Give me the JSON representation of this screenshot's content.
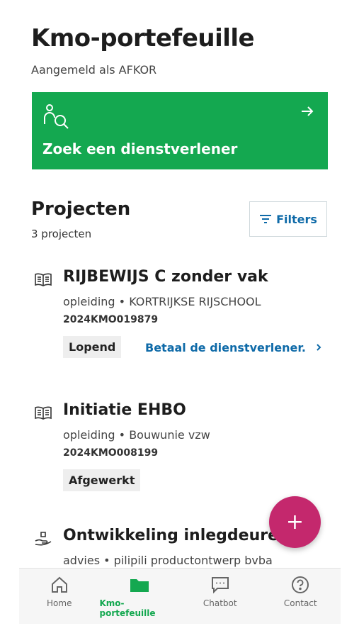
{
  "header": {
    "title": "Kmo-portefeuille",
    "subtitle": "Aangemeld als AFKOR"
  },
  "search_card": {
    "label": "Zoek een dienstverlener",
    "icon": "person-search-icon",
    "arrow": "arrow-right-icon"
  },
  "projects_section": {
    "title": "Projecten",
    "count": "3 projecten",
    "filters_label": "Filters"
  },
  "projects": [
    {
      "title": "RIJBEWIJS C zonder vak",
      "meta": "opleiding • KORTRIJKSE RIJSCHOOL",
      "code": "2024KMO019879",
      "status": "Lopend",
      "action": "Betaal de dienstverlener.",
      "icon": "book-icon"
    },
    {
      "title": "Initiatie EHBO",
      "meta": "opleiding • Bouwunie vzw",
      "code": "2024KMO008199",
      "status": "Afgewerkt",
      "icon": "book-icon"
    },
    {
      "title": "Ontwikkeling inlegdeuren",
      "meta": "advies • pilipili productontwerp bvba",
      "icon": "hand-box-icon"
    }
  ],
  "fab": {
    "label": "+"
  },
  "bottom_nav": [
    {
      "label": "Home",
      "icon": "home-icon",
      "active": false
    },
    {
      "label": "Kmo-portefeuille",
      "icon": "folder-icon",
      "active": true
    },
    {
      "label": "Chatbot",
      "icon": "chat-icon",
      "active": false
    },
    {
      "label": "Contact",
      "icon": "help-icon",
      "active": false
    }
  ],
  "colors": {
    "primary_green": "#14a850",
    "link_blue": "#0e6aa8",
    "fab_pink": "#c4286d"
  }
}
